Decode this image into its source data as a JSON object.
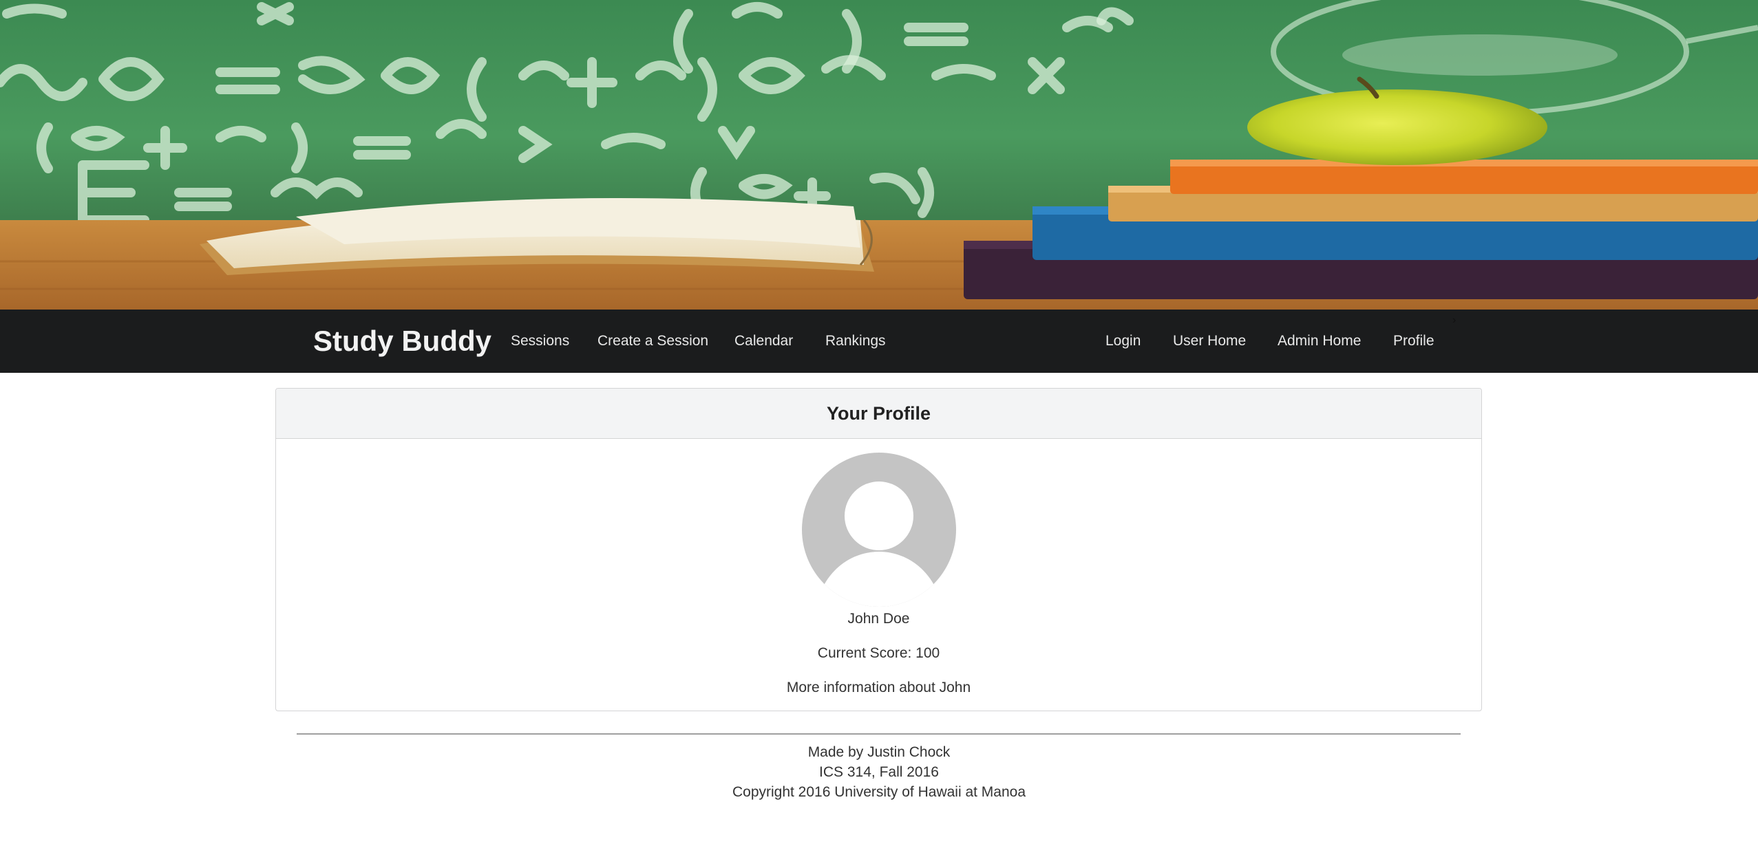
{
  "navbar": {
    "brand": "Study Buddy",
    "left_items": [
      {
        "label": "Sessions"
      },
      {
        "label": "Create a Session"
      },
      {
        "label": "Calendar"
      },
      {
        "label": "Rankings"
      }
    ],
    "right_items": [
      {
        "label": "Login"
      },
      {
        "label": "User Home"
      },
      {
        "label": "Admin Home"
      },
      {
        "label": "Profile"
      }
    ],
    "dropdown_indicator": "›"
  },
  "profile": {
    "header": "Your Profile",
    "avatar_icon": "user-avatar-placeholder-icon",
    "name": "John Doe",
    "score_text": "Current Score: 100",
    "info_text": "More information about John"
  },
  "footer": {
    "line1": "Made by Justin Chock",
    "line2": "ICS 314, Fall 2016",
    "line3": "Copyright 2016 University of Hawaii at Manoa"
  },
  "colors": {
    "navbar_bg": "#1b1c1d",
    "card_header_bg": "#f3f4f5",
    "avatar_gray": "#c4c4c4",
    "chalkboard_green": "#3f8f55"
  }
}
